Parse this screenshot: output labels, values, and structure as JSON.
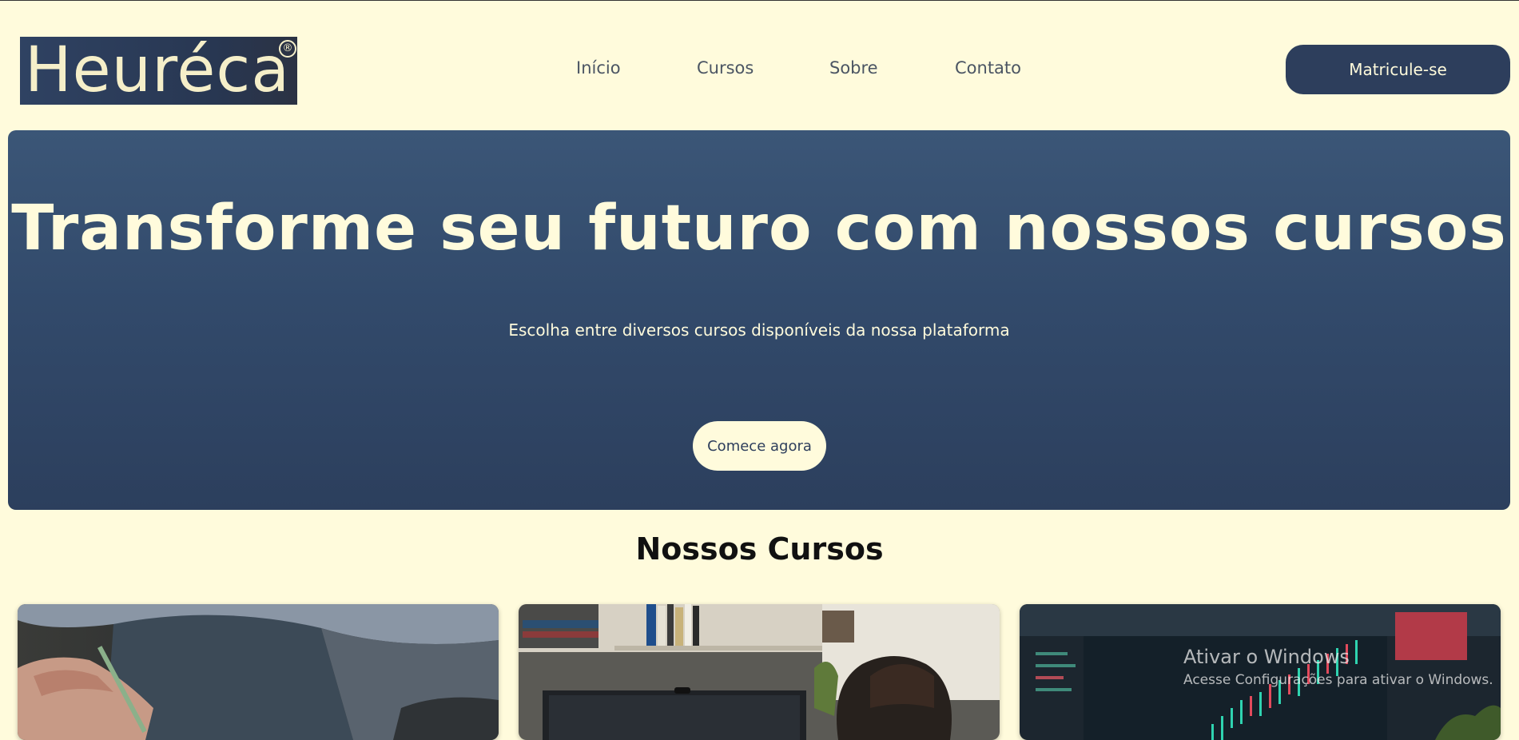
{
  "header": {
    "logo_text": "Heuréca",
    "logo_mark": "®",
    "nav": [
      "Início",
      "Cursos",
      "Sobre",
      "Contato"
    ],
    "enroll_label": "Matricule-se"
  },
  "hero": {
    "title": "Transforme seu futuro com nossos cursos",
    "subtitle": "Escolha entre diversos cursos disponíveis da nossa plataforma",
    "cta_label": "Comece agora"
  },
  "courses": {
    "title": "Nossos Cursos",
    "cards": [
      {
        "image": "person-cooking-photo"
      },
      {
        "image": "person-coding-desk-photo"
      },
      {
        "image": "trading-chart-screen-photo"
      }
    ]
  },
  "watermark": {
    "title": "Ativar o Windows",
    "subtitle": "Acesse Configurações para ativar o Windows."
  },
  "colors": {
    "background": "#fffbdc",
    "primary": "#2d3e5c",
    "hero_top": "#3b5677",
    "hero_bottom": "#2c3f5d",
    "cream": "#fffbdc"
  }
}
